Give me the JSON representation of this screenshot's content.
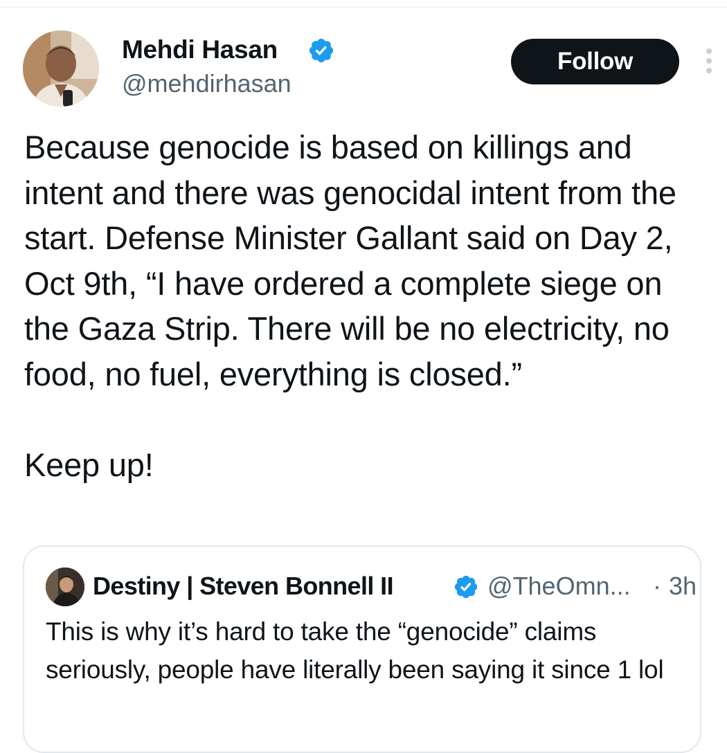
{
  "colors": {
    "text": "#0f1419",
    "secondary_text": "#536471",
    "verified_blue": "#1d9bf0",
    "follow_button_bg": "#0f1419",
    "follow_button_text": "#ffffff",
    "border": "#e1e8ed"
  },
  "tweet": {
    "author": {
      "name": "Mehdi Hasan",
      "handle": "@mehdirhasan",
      "verified_icon": "verified-badge-icon",
      "avatar_icon": "avatar-photo"
    },
    "follow_label": "Follow",
    "more_icon": "more-options-icon",
    "text": "Because genocide is based on killings and intent and there was genocidal intent from the start. Defense Minister Gallant said on Day 2, Oct 9th, “I have ordered a complete siege on the Gaza Strip. There will be no electricity, no food, no fuel, everything is closed.”\n\nKeep up!"
  },
  "quoted_tweet": {
    "author": {
      "name": "Destiny | Steven Bonnell II",
      "handle": "@TheOmn...",
      "verified_icon": "verified-badge-icon",
      "avatar_icon": "avatar-photo"
    },
    "separator": "·",
    "time": "3h",
    "text": "This is why it’s hard to take the “genocide” claims seriously, people have literally been saying it since 1 lol"
  }
}
